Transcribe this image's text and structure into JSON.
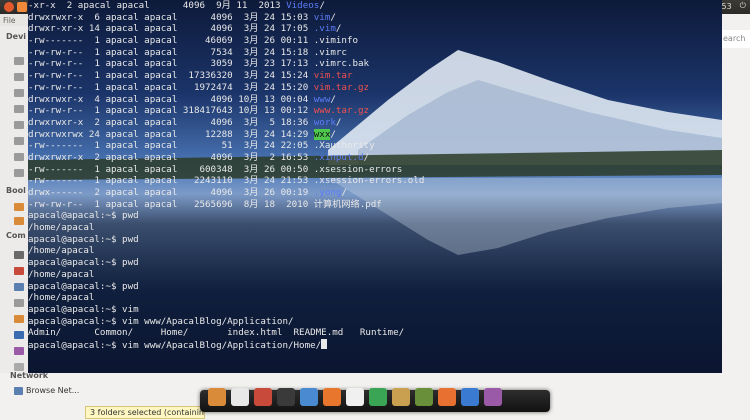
{
  "top_panel": {
    "clock": "00:53",
    "icons": [
      "close-icon",
      "minimize-icon",
      "maximize-icon",
      "mail-icon",
      "wifi-icon",
      "volume-icon",
      "power-icon"
    ]
  },
  "file_manager": {
    "menu_label": "File  Edi",
    "search_label": "earch",
    "sidebar_sections": {
      "devices": "Devi",
      "bookmarks": "Bool",
      "computer": "Com"
    },
    "network_title": "Network",
    "network_item": "Browse Net...",
    "status_text": "3 folders selected (containing"
  },
  "terminal": {
    "lines": [
      [
        {
          "t": "-xr-x  2 apacal apacal      4096  9月 11  2013 "
        },
        {
          "t": "Videos",
          "c": "dir"
        },
        {
          "t": "/"
        }
      ],
      [
        {
          "t": "drwxrwxr-x  6 apacal apacal      4096  3月 24 15:03 "
        },
        {
          "t": "vim",
          "c": "dir"
        },
        {
          "t": "/"
        }
      ],
      [
        {
          "t": "drwxr-xr-x 14 apacal apacal      4096  3月 24 17:05 "
        },
        {
          "t": ".vim",
          "c": "dir"
        },
        {
          "t": "/"
        }
      ],
      [
        {
          "t": "-rw-------  1 apacal apacal     46069  3月 26 00:11 .viminfo"
        }
      ],
      [
        {
          "t": "-rw-rw-r--  1 apacal apacal      7534  3月 24 15:18 .vimrc"
        }
      ],
      [
        {
          "t": "-rw-rw-r--  1 apacal apacal      3059  3月 23 17:13 .vimrc.bak"
        }
      ],
      [
        {
          "t": "-rw-rw-r--  1 apacal apacal  17336320  3月 24 15:24 "
        },
        {
          "t": "vim.tar",
          "c": "archive"
        }
      ],
      [
        {
          "t": "-rw-rw-r--  1 apacal apacal   1972474  3月 24 15:20 "
        },
        {
          "t": "vim.tar.gz",
          "c": "archive"
        }
      ],
      [
        {
          "t": "drwxrwxr-x  4 apacal apacal      4096 10月 13 00:04 "
        },
        {
          "t": "www",
          "c": "dir"
        },
        {
          "t": "/"
        }
      ],
      [
        {
          "t": "-rw-rw-r--  1 apacal apacal 318417643 10月 13 00:12 "
        },
        {
          "t": "www.tar.gz",
          "c": "archive"
        }
      ],
      [
        {
          "t": "drwxrwxr-x  2 apacal apacal      4096  3月  5 18:36 "
        },
        {
          "t": "work",
          "c": "dir"
        },
        {
          "t": "/"
        }
      ],
      [
        {
          "t": "drwxrwxrwx 24 apacal apacal     12288  3月 24 14:29 "
        },
        {
          "t": "wxx",
          "c": "other"
        },
        {
          "t": "/"
        }
      ],
      [
        {
          "t": "-rw-------  1 apacal apacal        51  3月 24 22:05 .Xauthority"
        }
      ],
      [
        {
          "t": "drwxrwxr-x  2 apacal apacal      4096  3月  2 16:53 "
        },
        {
          "t": ".xinput.d",
          "c": "dir"
        },
        {
          "t": "/"
        }
      ],
      [
        {
          "t": "-rw-------  1 apacal apacal    600348  3月 26 00:50 .xsession-errors"
        }
      ],
      [
        {
          "t": "-rw-------  1 apacal apacal   2243110  3月 24 21:53 .xsession-errors.old"
        }
      ],
      [
        {
          "t": "drwx------  2 apacal apacal      4096  3月 26 00:19 "
        },
        {
          "t": ".yong",
          "c": "dir"
        },
        {
          "t": "/"
        }
      ],
      [
        {
          "t": "-rw-rw-r--  1 apacal apacal   2565696  8月 18  2010 计算机网络.pdf"
        }
      ],
      [
        {
          "t": "apacal@apacal:~$ pwd"
        }
      ],
      [
        {
          "t": "/home/apacal"
        }
      ],
      [
        {
          "t": "apacal@apacal:~$ pwd"
        }
      ],
      [
        {
          "t": "/home/apacal"
        }
      ],
      [
        {
          "t": "apacal@apacal:~$ pwd"
        }
      ],
      [
        {
          "t": "/home/apacal"
        }
      ],
      [
        {
          "t": "apacal@apacal:~$ pwd"
        }
      ],
      [
        {
          "t": "/home/apacal"
        }
      ],
      [
        {
          "t": "apacal@apacal:~$ vim"
        }
      ],
      [
        {
          "t": "apacal@apacal:~$ vim www/ApacalBlog/Application/"
        }
      ],
      [
        {
          "t": "Admin/      Common/     Home/       index.html  README.md   Runtime/"
        }
      ],
      [
        {
          "t": "apacal@apacal:~$ vim www/ApacalBlog/Application/Home/"
        },
        {
          "t": "",
          "c": "cursor"
        }
      ]
    ],
    "colors": {
      "dir": "#5c7cf7",
      "archive": "#f05050",
      "other_bg": "#4ec94e",
      "text": "#e8e8e8"
    }
  },
  "dock": {
    "icons": [
      {
        "name": "files-icon",
        "color": "#d98b3a"
      },
      {
        "name": "text-editor-icon",
        "color": "#e8e8e8"
      },
      {
        "name": "mail-app-icon",
        "color": "#c84a3a"
      },
      {
        "name": "terminal-icon",
        "color": "#3a3a3a"
      },
      {
        "name": "chat-icon",
        "color": "#4a8ad0"
      },
      {
        "name": "firefox-icon",
        "color": "#e8762c"
      },
      {
        "name": "document-icon",
        "color": "#f0f0f0"
      },
      {
        "name": "chrome-icon",
        "color": "#3aa655"
      },
      {
        "name": "dictionary-icon",
        "color": "#c8a050"
      },
      {
        "name": "books-icon",
        "color": "#6a8f3a"
      },
      {
        "name": "image-viewer-icon",
        "color": "#e87030"
      },
      {
        "name": "accessibility-icon",
        "color": "#3a7ad0"
      },
      {
        "name": "window-icon",
        "color": "#9a5aa8"
      }
    ]
  }
}
